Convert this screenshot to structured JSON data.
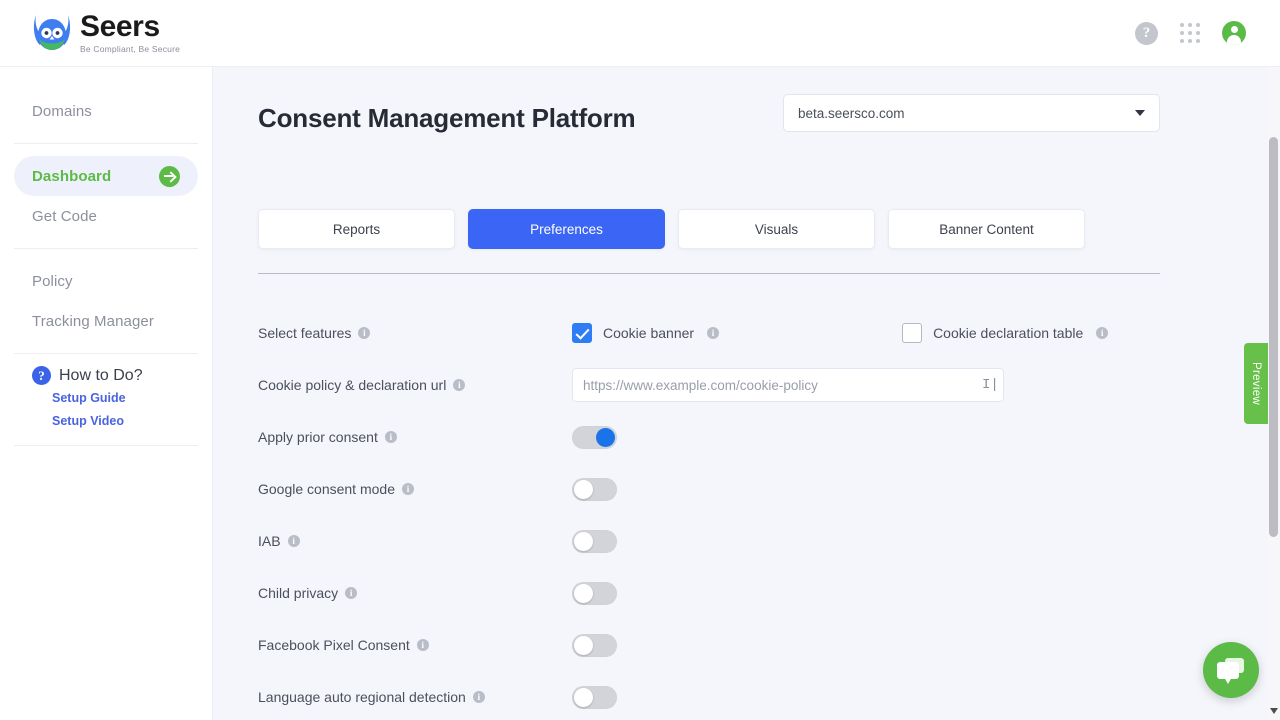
{
  "header": {
    "brand_name": "Seers",
    "brand_tagline": "Be Compliant, Be Secure",
    "help_glyph": "?",
    "icons": {
      "help": "help-circle-icon",
      "apps": "apps-grid-icon",
      "avatar": "user-avatar-icon"
    }
  },
  "sidebar": {
    "items": [
      {
        "label": "Domains",
        "active": false
      },
      {
        "label": "Dashboard",
        "active": true
      },
      {
        "label": "Get Code",
        "active": false
      },
      {
        "label": "Policy",
        "active": false
      },
      {
        "label": "Tracking Manager",
        "active": false
      }
    ],
    "howto": {
      "title": "How to Do?",
      "icon_glyph": "?",
      "links": [
        "Setup Guide",
        "Setup Video"
      ]
    }
  },
  "main": {
    "page_title": "Consent Management Platform",
    "domain_select": {
      "value": "beta.seersco.com",
      "options": [
        "beta.seersco.com"
      ]
    },
    "tabs": [
      {
        "label": "Reports",
        "active": false
      },
      {
        "label": "Preferences",
        "active": true
      },
      {
        "label": "Visuals",
        "active": false
      },
      {
        "label": "Banner Content",
        "active": false
      }
    ],
    "select_features": {
      "label": "Select features",
      "options": [
        {
          "label": "Cookie banner",
          "checked": true
        },
        {
          "label": "Cookie declaration table",
          "checked": false
        }
      ]
    },
    "cookie_policy_url": {
      "label": "Cookie policy & declaration url",
      "value": "",
      "placeholder": "https://www.example.com/cookie-policy"
    },
    "toggles": [
      {
        "label": "Apply prior consent",
        "on": true
      },
      {
        "label": "Google consent mode",
        "on": false
      },
      {
        "label": "IAB",
        "on": false
      },
      {
        "label": "Child privacy",
        "on": false
      },
      {
        "label": "Facebook Pixel Consent",
        "on": false
      },
      {
        "label": "Language auto regional detection",
        "on": false
      }
    ]
  },
  "rail": {
    "preview_label": "Preview"
  },
  "colors": {
    "accent_blue": "#3b65f5",
    "brand_green": "#5cbb46",
    "toggle_on": "#1a73e8",
    "link_blue": "#4a63e0",
    "page_bg": "#f5f6fc"
  }
}
